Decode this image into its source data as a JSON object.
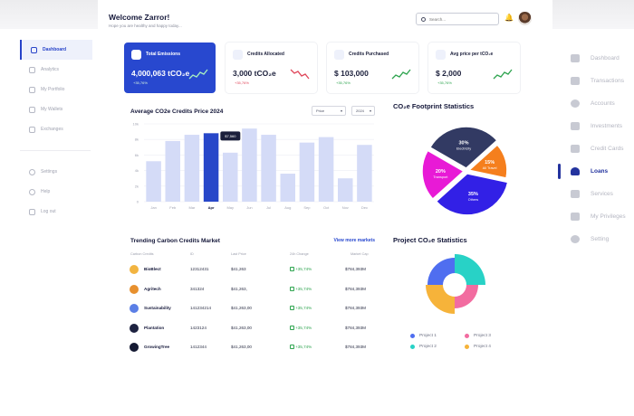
{
  "header": {
    "welcome": "Welcome Zarror!",
    "subtitle": "Hope you are healthy and happy today...",
    "search_placeholder": "Search..."
  },
  "left_nav": {
    "items": [
      {
        "label": "Dashboard",
        "active": true
      },
      {
        "label": "Analytics"
      },
      {
        "label": "My Portfolio"
      },
      {
        "label": "My Wallets"
      },
      {
        "label": "Exchanges"
      }
    ],
    "bottom": [
      {
        "label": "Settings"
      },
      {
        "label": "Help"
      },
      {
        "label": "Log out"
      }
    ]
  },
  "right_nav": {
    "items": [
      {
        "label": "Dashboard",
        "icon": "home-icon"
      },
      {
        "label": "Transactions",
        "icon": "transactions-icon"
      },
      {
        "label": "Accounts",
        "icon": "user-icon"
      },
      {
        "label": "Investments",
        "icon": "investments-icon"
      },
      {
        "label": "Credit Cards",
        "icon": "credit-card-icon"
      },
      {
        "label": "Loans",
        "icon": "loans-icon",
        "active": true
      },
      {
        "label": "Services",
        "icon": "services-icon"
      },
      {
        "label": "My Privileges",
        "icon": "privileges-icon"
      },
      {
        "label": "Setting",
        "icon": "setting-icon"
      }
    ]
  },
  "cards": [
    {
      "title": "Total Emissions",
      "value": "4,000,063 tCO₂e",
      "change": "+35,76%",
      "trend": "up",
      "active": true
    },
    {
      "title": "Credits Allocated",
      "value": "3,000 tCO₂e",
      "change": "+35,76%",
      "trend": "down"
    },
    {
      "title": "Credits Purchased",
      "value": "$ 103,000",
      "change": "+35,76%",
      "trend": "up"
    },
    {
      "title": "Avg price per tCO₂e",
      "value": "$ 2,000",
      "change": "+35,76%",
      "trend": "up"
    }
  ],
  "bar_panel": {
    "title": "Average CO2e Credits Price 2024",
    "filter_metric": "Price",
    "filter_year": "2024",
    "tooltip": "$7,560"
  },
  "chart_data": {
    "type": "bar",
    "categories": [
      "Jan",
      "Feb",
      "Mar",
      "Apr",
      "May",
      "Jun",
      "Jul",
      "Aug",
      "Sep",
      "Oct",
      "Nov",
      "Dec"
    ],
    "values": [
      5.2,
      7.8,
      8.6,
      8.8,
      6.3,
      9.4,
      8.6,
      3.6,
      7.6,
      8.3,
      3.0,
      7.3
    ],
    "highlight_index": 3,
    "y_ticks": [
      "0",
      "2k",
      "4k",
      "6k",
      "8k",
      "10k"
    ],
    "ylim": [
      0,
      10
    ],
    "grid": true,
    "colors": {
      "bar": "#d4dbf7",
      "highlight": "#2747c9"
    }
  },
  "market": {
    "title": "Trending Carbon Credits Market",
    "view_more": "View more markets",
    "columns": [
      "Carbon Credits",
      "ID",
      "Last Price",
      "24h Change",
      "Market Cap"
    ],
    "rows": [
      {
        "name": "BioBlect",
        "id": "12312431",
        "price": "$41,263",
        "change": "+35,74%",
        "cap": "$784,393M",
        "color": "#f2b441"
      },
      {
        "name": "Agritech",
        "id": "341324",
        "price": "$41,263,",
        "change": "+35,74%",
        "cap": "$784,393M",
        "color": "#e7902e"
      },
      {
        "name": "Sustainability",
        "id": "141234214",
        "price": "$41,263,00",
        "change": "+35,74%",
        "cap": "$784,393M",
        "color": "#5b7fe6"
      },
      {
        "name": "Plantation",
        "id": "1423124",
        "price": "$41,263,00",
        "change": "+35,74%",
        "cap": "$784,393M",
        "color": "#1d2240"
      },
      {
        "name": "GrowingTree",
        "id": "1412344",
        "price": "$41,263,00",
        "change": "+35,74%",
        "cap": "$784,393M",
        "color": "#151a33"
      }
    ]
  },
  "footprint": {
    "title": "CO₂e Footprint Statistics",
    "slices": [
      {
        "label": "Electricity",
        "value": 30,
        "color": "#323a63"
      },
      {
        "label": "All Travel",
        "value": 15,
        "color": "#f57f1d"
      },
      {
        "label": "Others",
        "value": 35,
        "color": "#3220e6"
      },
      {
        "label": "Transport",
        "value": 20,
        "color": "#e81ad6"
      }
    ]
  },
  "projects": {
    "title": "Project CO₂e Statistics",
    "slices": [
      {
        "label": "Project 1",
        "value": 25,
        "color": "#4f6ef0"
      },
      {
        "label": "Project 2",
        "value": 25,
        "color": "#28d2c6"
      },
      {
        "label": "Project 3",
        "value": 25,
        "color": "#f26ca0"
      },
      {
        "label": "Project 4",
        "value": 25,
        "color": "#f6b33a"
      }
    ]
  }
}
